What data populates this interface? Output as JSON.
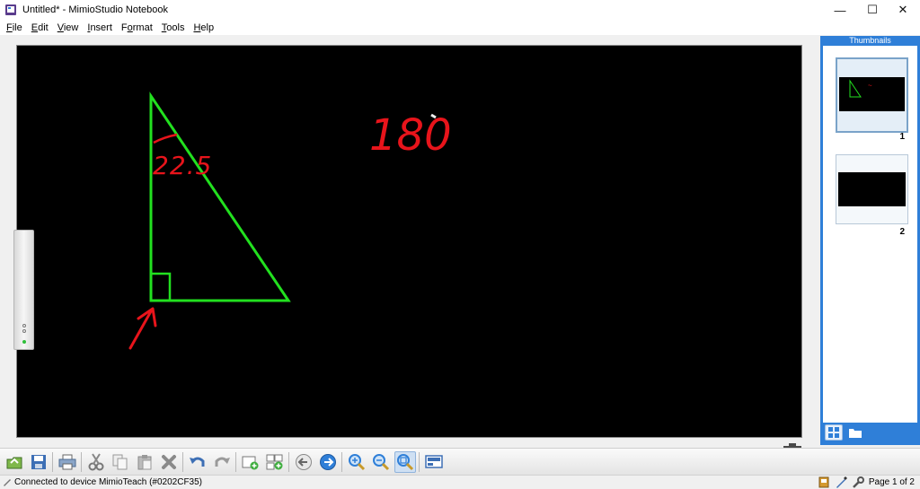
{
  "window": {
    "title": "Untitled* - MimioStudio Notebook",
    "controls": {
      "minimize": "—",
      "maximize": "☐",
      "close": "✕"
    }
  },
  "menu": [
    {
      "label": "File",
      "accel": "F",
      "rest": "ile"
    },
    {
      "label": "Edit",
      "accel": "E",
      "rest": "dit"
    },
    {
      "label": "View",
      "accel": "V",
      "rest": "iew"
    },
    {
      "label": "Insert",
      "accel": "I",
      "rest": "nsert"
    },
    {
      "label": "Format",
      "accel": "F",
      "rest": "ormat",
      "prefix": ""
    },
    {
      "label": "Tools",
      "accel": "T",
      "rest": "ools"
    },
    {
      "label": "Help",
      "accel": "H",
      "rest": "elp"
    }
  ],
  "canvas": {
    "background": "#000000",
    "handwriting": {
      "angle_label": "22.5",
      "note": "180"
    },
    "colors": {
      "shape": "#22e01f",
      "ink": "#e8141b"
    }
  },
  "thumbnails": {
    "header": "Thumbnails",
    "pages": [
      {
        "number": "1",
        "selected": true
      },
      {
        "number": "2",
        "selected": false
      }
    ]
  },
  "toolbar": {
    "buttons": [
      "open-icon",
      "save-icon",
      "print-icon",
      "cut-icon",
      "copy-icon",
      "paste-icon",
      "delete-icon",
      "undo-icon",
      "redo-icon",
      "new-page-icon",
      "duplicate-page-icon",
      "previous-page-icon",
      "next-page-icon",
      "zoom-in-icon",
      "zoom-out-icon",
      "zoom-fit-icon",
      "display-icon"
    ]
  },
  "status": {
    "connection": "Connected to device MimioTeach (#0202CF35)",
    "page": "Page 1 of 2"
  }
}
